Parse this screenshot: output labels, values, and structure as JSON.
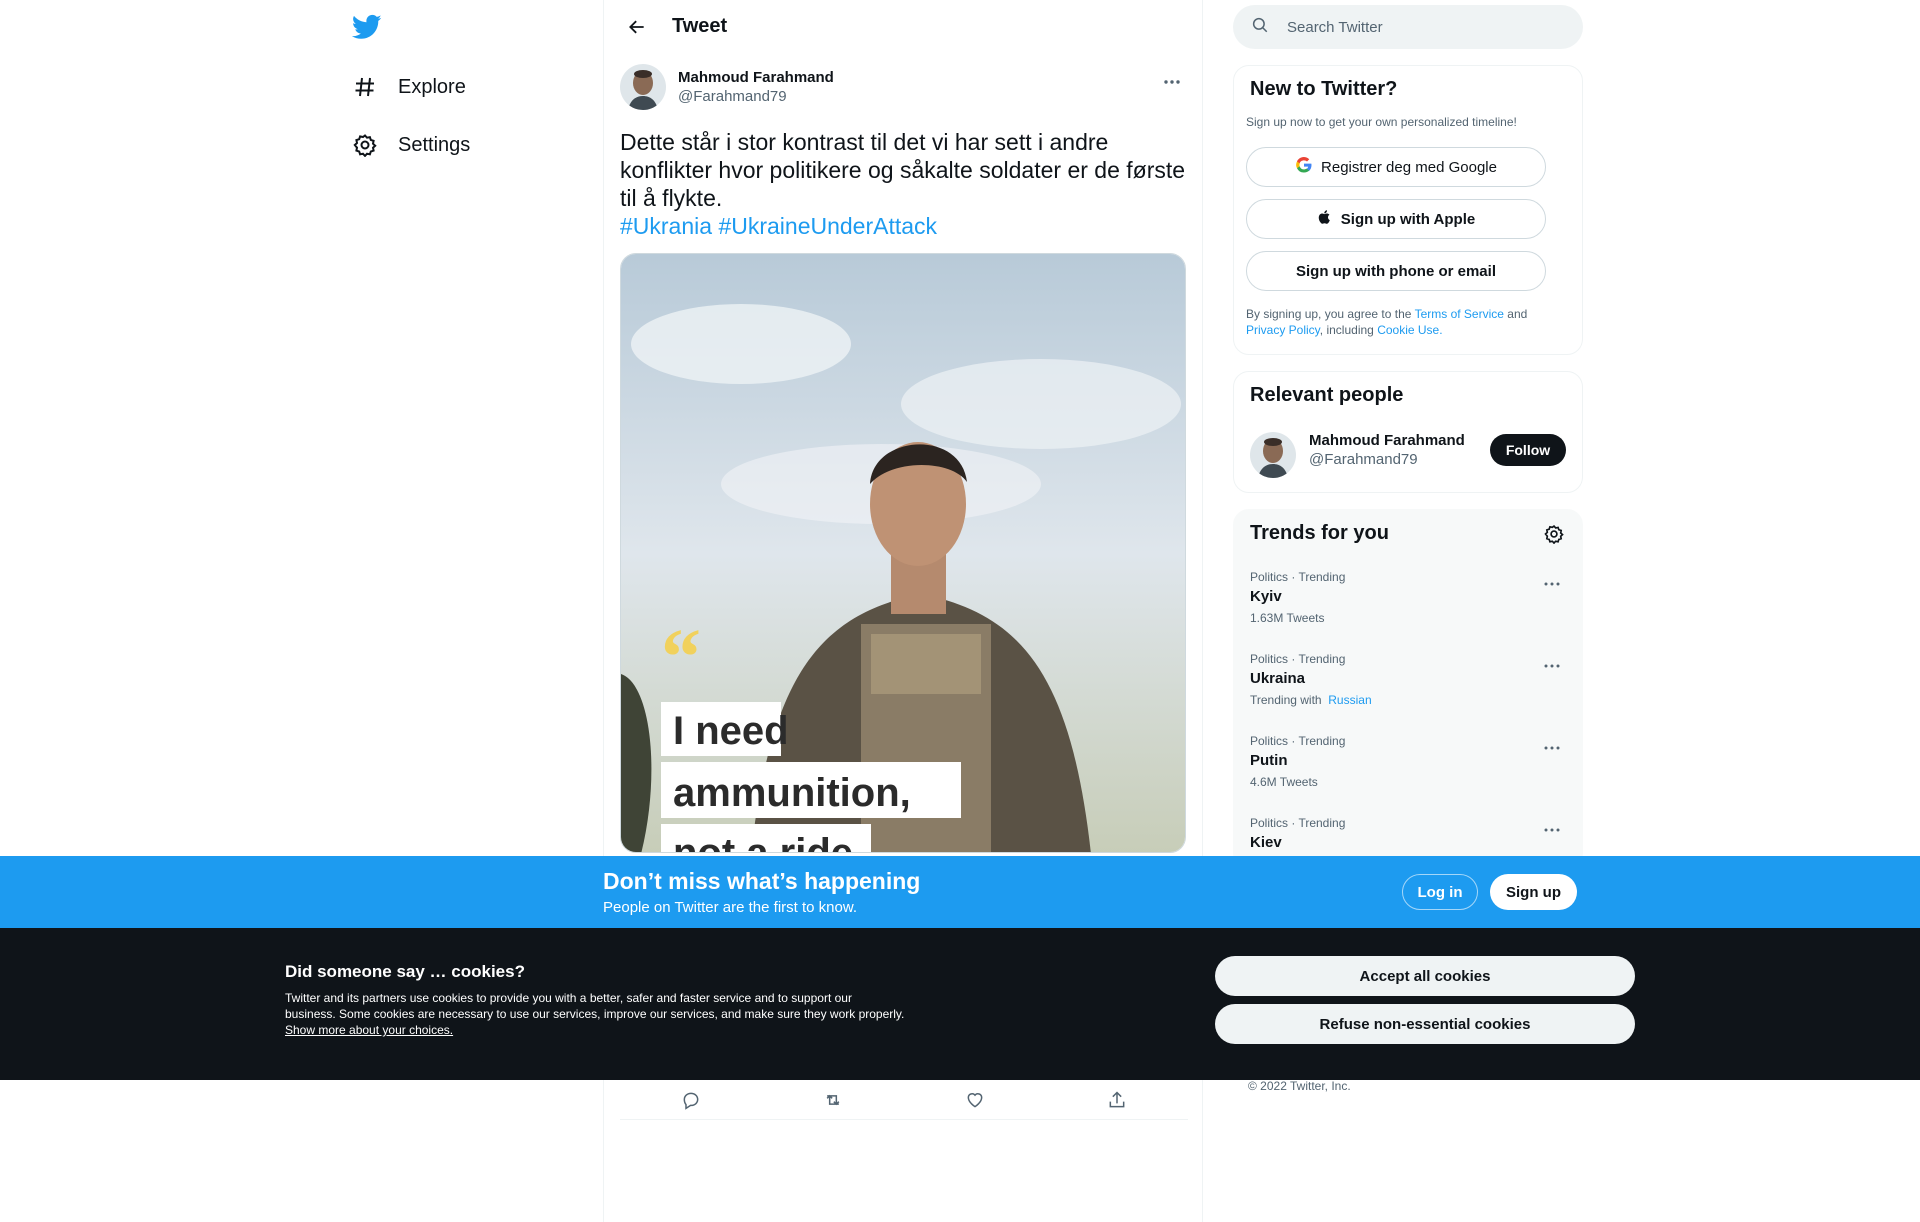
{
  "nav": {
    "explore": "Explore",
    "settings": "Settings"
  },
  "main": {
    "header_title": "Tweet",
    "author_name": "Mahmoud Farahmand",
    "author_handle": "@Farahmand79",
    "tweet_text": "Dette står i stor kontrast til det vi har sett i andre konflikter hvor politikere og såkalte soldater er de første til å flykte.",
    "hashtags": [
      "#Ukrania",
      "#UkraineUnderAttack"
    ],
    "media_quote_lines": [
      "I need",
      "ammunition,",
      "not a ride"
    ]
  },
  "search": {
    "placeholder": "Search Twitter"
  },
  "new_to_twitter": {
    "title": "New to Twitter?",
    "subtitle": "Sign up now to get your own personalized timeline!",
    "google_label": "Registrer deg med Google",
    "apple_label": "Sign up with Apple",
    "phone_label": "Sign up with phone or email",
    "terms_prefix": "By signing up, you agree to the",
    "terms_link": "Terms of Service",
    "terms_and": "and",
    "privacy_link": "Privacy Policy",
    "including": ", including",
    "cookie_link": "Cookie Use."
  },
  "relevant": {
    "title": "Relevant people",
    "name": "Mahmoud Farahmand",
    "handle": "@Farahmand79",
    "follow_label": "Follow"
  },
  "trends": {
    "title": "Trends for you",
    "items": [
      {
        "meta": "Politics · Trending",
        "name": "Kyiv",
        "sub": "1.63M Tweets",
        "sub_link": ""
      },
      {
        "meta": "Politics · Trending",
        "name": "Ukraina",
        "sub": "Trending with",
        "sub_link": "Russian"
      },
      {
        "meta": "Politics · Trending",
        "name": "Putin",
        "sub": "4.6M Tweets",
        "sub_link": ""
      },
      {
        "meta": "Politics · Trending",
        "name": "Kiev",
        "sub": "",
        "sub_link": ""
      }
    ]
  },
  "copyright": "© 2022 Twitter, Inc.",
  "banner": {
    "title": "Don’t miss what’s happening",
    "subtitle": "People on Twitter are the first to know.",
    "login_label": "Log in",
    "signup_label": "Sign up"
  },
  "cookies": {
    "title": "Did someone say … cookies?",
    "body": "Twitter and its partners use cookies to provide you with a better, safer and faster service and to support our business. Some cookies are necessary to use our services, improve our services, and make sure they work properly.",
    "more_link": "Show more about your choices.",
    "accept_label": "Accept all cookies",
    "refuse_label": "Refuse non-essential cookies"
  },
  "colors": {
    "accent": "#1d9bf0",
    "text": "#0f1419",
    "secondary": "#536471",
    "cookie_bg": "#0f1419"
  },
  "icons": [
    "twitter-bird-icon",
    "hashtag-icon",
    "gear-icon",
    "back-arrow-icon",
    "more-icon",
    "search-icon",
    "google-icon",
    "apple-icon",
    "reply-icon",
    "retweet-icon",
    "like-icon",
    "share-icon"
  ]
}
